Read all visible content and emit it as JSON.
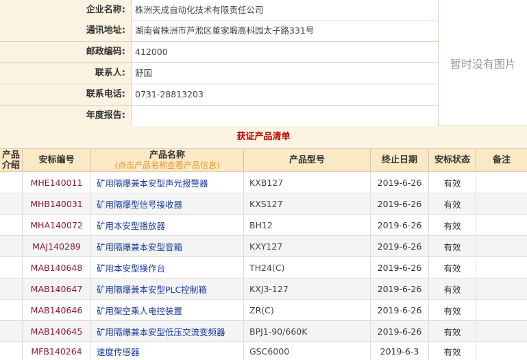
{
  "company": {
    "name_label": "企业名称:",
    "name": "株洲天成自动化技术有限责任公司",
    "address_label": "通讯地址:",
    "address": "湖南省株洲市芦淞区董家塅高科园太子路331号",
    "postcode_label": "邮政编码:",
    "postcode": "412000",
    "contact_label": "联系人:",
    "contact": "舒国",
    "phone_label": "联系电话:",
    "phone": "0731-28813203",
    "report_label": "年度报告:",
    "report": ""
  },
  "no_image_text": "暂时没有图片",
  "list_title": "获证产品清单",
  "headers": {
    "intro": "产品介绍",
    "code": "安标编号",
    "name": "产品名称",
    "name_hint": "(点击产品名称查看产品信息)",
    "model": "产品型号",
    "date": "终止日期",
    "status": "安标状态",
    "note": "备注"
  },
  "products": [
    {
      "code": "MHE140011",
      "name": "矿用隔爆兼本安型声光报警器",
      "model": "KXB127",
      "date": "2019-6-26",
      "status": "有效",
      "note": ""
    },
    {
      "code": "MHB140031",
      "name": "矿用隔爆型信号接收器",
      "model": "KXS127",
      "date": "2019-6-26",
      "status": "有效",
      "note": ""
    },
    {
      "code": "MHA140072",
      "name": "矿用本安型播放器",
      "model": "BH12",
      "date": "2019-6-26",
      "status": "有效",
      "note": ""
    },
    {
      "code": "MAJ140289",
      "name": "矿用隔爆兼本安型音箱",
      "model": "KXY127",
      "date": "2019-6-26",
      "status": "有效",
      "note": ""
    },
    {
      "code": "MAB140648",
      "name": "矿用本安型操作台",
      "model": "TH24(C)",
      "date": "2019-6-26",
      "status": "有效",
      "note": ""
    },
    {
      "code": "MAB140647",
      "name": "矿用隔爆兼本安型PLC控制箱",
      "model": "KXJ3-127",
      "date": "2019-6-26",
      "status": "有效",
      "note": ""
    },
    {
      "code": "MAB140646",
      "name": "矿用架空乘人电控装置",
      "model": "ZR(C)",
      "date": "2019-6-26",
      "status": "有效",
      "note": ""
    },
    {
      "code": "MAB140645",
      "name": "矿用隔爆兼本安型低压交流变频器",
      "model": "BPJ1-90/660K",
      "date": "2019-6-26",
      "status": "有效",
      "note": ""
    },
    {
      "code": "MFB140264",
      "name": "速度传感器",
      "model": "GSC6000",
      "date": "2019-6-3",
      "status": "有效",
      "note": ""
    }
  ]
}
